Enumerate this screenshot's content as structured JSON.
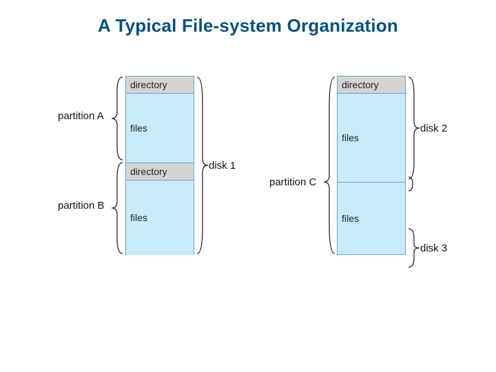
{
  "title": "A Typical File-system Organization",
  "labels": {
    "partitionA": "partition A",
    "partitionB": "partition B",
    "partitionC": "partition C",
    "disk1": "disk 1",
    "disk2": "disk 2",
    "disk3": "disk 3"
  },
  "cells": {
    "directory": "directory",
    "files": "files"
  },
  "chart_data": {
    "type": "table",
    "description": "File-system organization showing partitions spanning disks",
    "disks": [
      {
        "name": "disk 1",
        "contains_partitions": [
          "partition A",
          "partition B"
        ]
      },
      {
        "name": "disk 2",
        "part_of_partition": "partition C"
      },
      {
        "name": "disk 3",
        "part_of_partition": "partition C"
      }
    ],
    "partitions": [
      {
        "name": "partition A",
        "components": [
          "directory",
          "files"
        ],
        "spans": [
          "top half of disk 1"
        ]
      },
      {
        "name": "partition B",
        "components": [
          "directory",
          "files"
        ],
        "spans": [
          "bottom half of disk 1"
        ]
      },
      {
        "name": "partition C",
        "components": [
          "directory",
          "files",
          "files"
        ],
        "spans": [
          "disk 2",
          "disk 3"
        ]
      }
    ]
  }
}
